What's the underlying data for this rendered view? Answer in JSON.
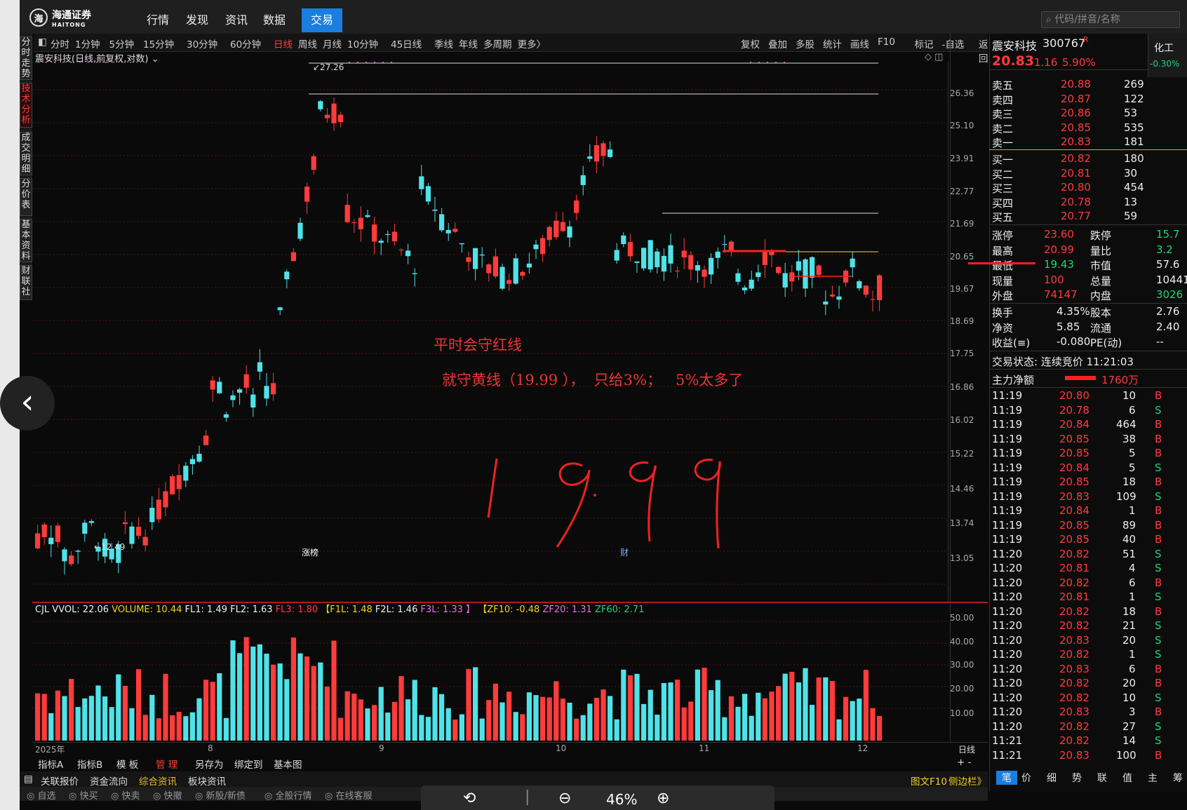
{
  "nav": {
    "logo": "海通证券",
    "logo_sub": "HAITONG",
    "tabs": [
      "行情",
      "发现",
      "资讯",
      "数据",
      "交易"
    ],
    "active_tab": "交易",
    "search_placeholder": "代码/拼音/名称"
  },
  "sidebar_tabs": [
    "分时走势",
    "技术分析",
    "成交明细",
    "分价表",
    "基本资料",
    "财联社"
  ],
  "sidebar_active": "技术分析",
  "periods": [
    "分时",
    "1分钟",
    "5分钟",
    "15分钟",
    "30分钟",
    "60分钟",
    "日线",
    "周线",
    "月线",
    "10分钟",
    "45日线",
    "季线",
    "年线",
    "多周期",
    "更多〉"
  ],
  "period_active": "日线",
  "tools": [
    "复权",
    "叠加",
    "多股",
    "统计",
    "画线",
    "F10",
    "标记",
    "-自选",
    "返回"
  ],
  "chart_title": "震安科技(日线,前复权,对数)",
  "price_axis": [
    "26.36",
    "25.10",
    "23.91",
    "22.77",
    "21.69",
    "20.65",
    "19.67",
    "18.69",
    "17.75",
    "16.86",
    "16.02",
    "15.22",
    "14.46",
    "13.74",
    "13.05"
  ],
  "marks": {
    "high": "27.26",
    "low": "12.49",
    "tag1": "涨榜",
    "tag2": "财"
  },
  "annotations": {
    "line1": "平时会守红线",
    "line2": "就守黄线（19.99 ），  只给3%；   5%太多了",
    "handwritten": "19.99"
  },
  "volume": {
    "label": "CJL",
    "vvol": "VVOL: 22.06",
    "volume": "VOLUME: 10.44",
    "fl1": "FL1: 1.49",
    "fl2": "FL2: 1.63",
    "fl3": "FL3: 1.80",
    "f1l": "【F1L: 1.48",
    "f2l": "F2L: 1.46",
    "f3l": "F3L: 1.33 】",
    "zf10": "【ZF10: -0.48",
    "zf20": "ZF20: 1.31",
    "zf60": "ZF60: 2.71",
    "axis": [
      "50.00",
      "40.00",
      "30.00",
      "20.00",
      "10.00"
    ]
  },
  "xaxis": {
    "labels": [
      "2025年",
      "8",
      "9",
      "10",
      "11",
      "12"
    ],
    "period": "日线"
  },
  "bottom_tabs1": [
    "指标A",
    "指标B",
    "模 板",
    "管 理",
    "另存为",
    "绑定到",
    "基本图"
  ],
  "bottom_tabs2": [
    "关联报价",
    "资金流向",
    "综合资讯",
    "板块资讯"
  ],
  "bottom_right": [
    "图文F10",
    "侧边栏》"
  ],
  "bottom_tabs3": [
    "自选",
    "快买",
    "快卖",
    "快撤",
    "新股/新债",
    "全股行情",
    "在线客服"
  ],
  "zoom": {
    "level": "46%"
  },
  "quote": {
    "name": "震安科技",
    "code": "300767",
    "r": "R",
    "price": "20.83",
    "change": "1.16",
    "pct": "5.90%",
    "side_label": "化工",
    "side_pct": "-0.30%",
    "asks": [
      [
        "卖五",
        "20.88",
        "269"
      ],
      [
        "卖四",
        "20.87",
        "122"
      ],
      [
        "卖三",
        "20.86",
        "53"
      ],
      [
        "卖二",
        "20.85",
        "535"
      ],
      [
        "卖一",
        "20.83",
        "181"
      ]
    ],
    "bids": [
      [
        "买一",
        "20.82",
        "180"
      ],
      [
        "买二",
        "20.81",
        "30"
      ],
      [
        "买三",
        "20.80",
        "454"
      ],
      [
        "买四",
        "20.78",
        "13"
      ],
      [
        "买五",
        "20.77",
        "59"
      ]
    ],
    "stats": [
      [
        "涨停",
        "23.60",
        "跌停",
        "15.7"
      ],
      [
        "最高",
        "20.99",
        "量比",
        "3.2"
      ],
      [
        "最低",
        "19.43",
        "市值",
        "57.6"
      ],
      [
        "现量",
        "100",
        "总量",
        "10441"
      ],
      [
        "外盘",
        "74147",
        "内盘",
        "3026"
      ]
    ],
    "stats2": [
      [
        "换手",
        "4.35%",
        "股本",
        "2.76"
      ],
      [
        "净资",
        "5.85",
        "流通",
        "2.40"
      ],
      [
        "收益(≡)",
        "-0.080",
        "PE(动)",
        "--"
      ]
    ],
    "status": "交易状态: 连续竞价 11:21:03",
    "mainforce": "主力净额",
    "mainforce_val": "1760万",
    "ticks": [
      [
        "11:19",
        "20.80",
        "10",
        "B"
      ],
      [
        "11:19",
        "20.78",
        "6",
        "S"
      ],
      [
        "11:19",
        "20.84",
        "464",
        "B"
      ],
      [
        "11:19",
        "20.85",
        "38",
        "B"
      ],
      [
        "11:19",
        "20.85",
        "5",
        "B"
      ],
      [
        "11:19",
        "20.84",
        "5",
        "S"
      ],
      [
        "11:19",
        "20.85",
        "18",
        "B"
      ],
      [
        "11:19",
        "20.83",
        "109",
        "S"
      ],
      [
        "11:19",
        "20.84",
        "1",
        "B"
      ],
      [
        "11:19",
        "20.85",
        "89",
        "B"
      ],
      [
        "11:19",
        "20.85",
        "40",
        "B"
      ],
      [
        "11:20",
        "20.82",
        "51",
        "S"
      ],
      [
        "11:20",
        "20.81",
        "4",
        "S"
      ],
      [
        "11:20",
        "20.82",
        "6",
        "B"
      ],
      [
        "11:20",
        "20.81",
        "1",
        "S"
      ],
      [
        "11:20",
        "20.82",
        "18",
        "B"
      ],
      [
        "11:20",
        "20.82",
        "21",
        "S"
      ],
      [
        "11:20",
        "20.83",
        "20",
        "S"
      ],
      [
        "11:20",
        "20.82",
        "1",
        "S"
      ],
      [
        "11:20",
        "20.83",
        "6",
        "B"
      ],
      [
        "11:20",
        "20.82",
        "20",
        "B"
      ],
      [
        "11:20",
        "20.82",
        "10",
        "S"
      ],
      [
        "11:20",
        "20.83",
        "3",
        "B"
      ],
      [
        "11:20",
        "20.82",
        "27",
        "S"
      ],
      [
        "11:21",
        "20.82",
        "14",
        "S"
      ],
      [
        "11:21",
        "20.83",
        "100",
        "B"
      ]
    ],
    "tabs": [
      "笔",
      "价",
      "细",
      "势",
      "联",
      "值",
      "主",
      "筹"
    ]
  }
}
